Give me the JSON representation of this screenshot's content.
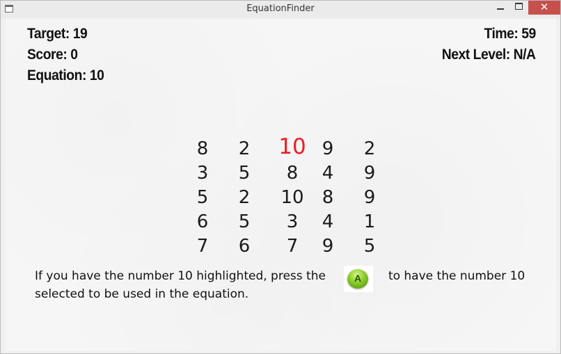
{
  "window": {
    "title": "EquationFinder",
    "close_glyph": "✕"
  },
  "hud": {
    "target": "Target: 19",
    "score": "Score: 0",
    "equation": "Equation: 10",
    "time": "Time:  59",
    "next_level": "Next Level: N/A"
  },
  "grid": {
    "rows": [
      [
        "8",
        "2",
        "10",
        "9",
        "2"
      ],
      [
        "3",
        "5",
        "8",
        "4",
        "9"
      ],
      [
        "5",
        "2",
        "10",
        "8",
        "9"
      ],
      [
        "6",
        "5",
        "3",
        "4",
        "1"
      ],
      [
        "7",
        "6",
        "7",
        "9",
        "5"
      ]
    ],
    "highlighted": {
      "row": 0,
      "col": 2
    },
    "highlight_color": "#ee1c24"
  },
  "hint": {
    "line1_before": "If you have the number 10 highlighted, press the",
    "line1_after": "to have the number 10",
    "line2": "selected to be used in the equation.",
    "button_label": "A",
    "button_icon": "green-a-button-icon"
  }
}
